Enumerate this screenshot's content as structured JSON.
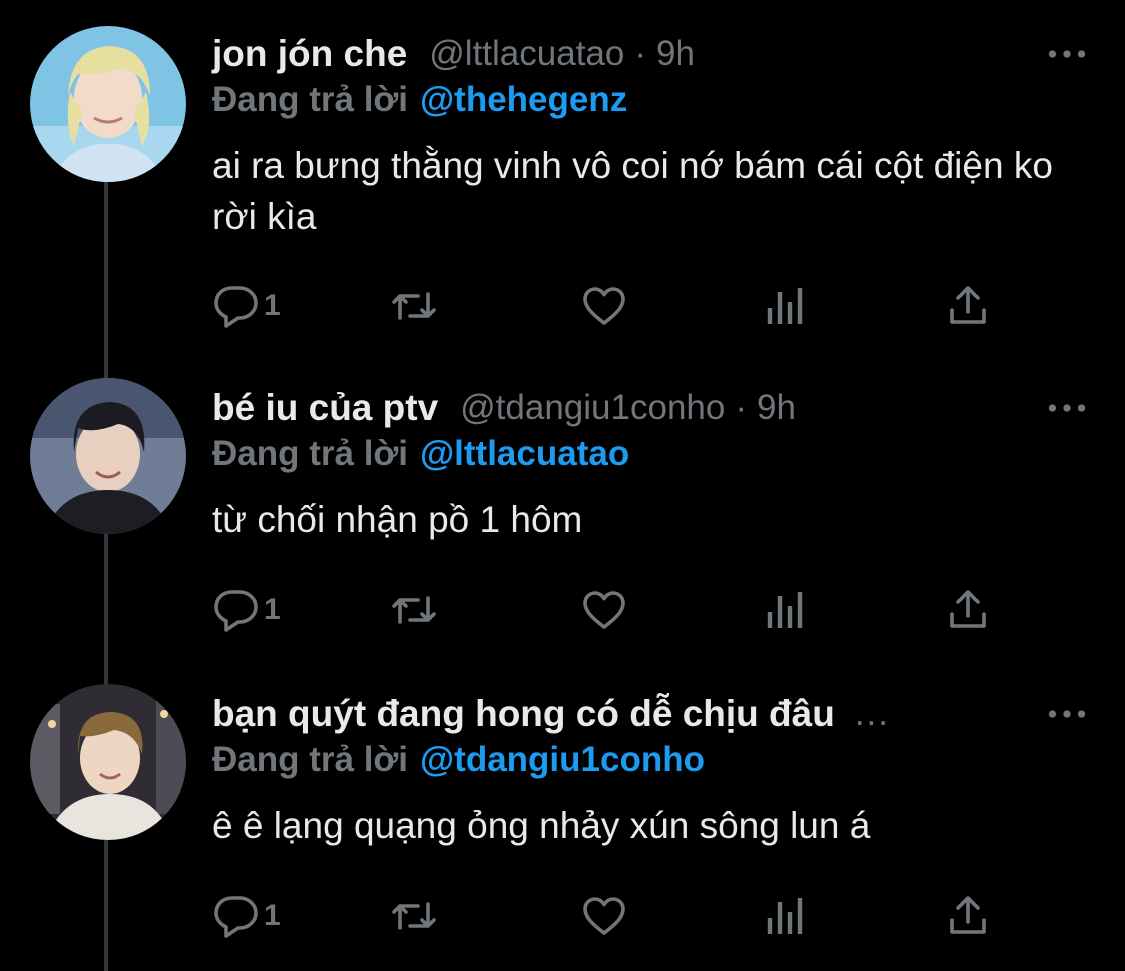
{
  "tweets": [
    {
      "display_name": "jon jón che",
      "handle": "@lttlacuatao",
      "separator": "·",
      "time": "9h",
      "truncated": "",
      "reply_label": "Đang trả lời",
      "reply_to": "@thehegenz",
      "text": "ai ra bưng thằng vinh vô coi nớ bám cái cột điện ko rời kìa",
      "reply_count": "1",
      "avatar_icon": "avatar-blonde-hair"
    },
    {
      "display_name": "bé iu của ptv",
      "handle": "@tdangiu1conho",
      "separator": "·",
      "time": "9h",
      "truncated": "",
      "reply_label": "Đang trả lời",
      "reply_to": "@lttlacuatao",
      "text": "từ chối nhận pồ 1 hôm",
      "reply_count": "1",
      "avatar_icon": "avatar-dark-hair"
    },
    {
      "display_name": "bạn quýt đang hong có dễ chịu đâu",
      "handle": "",
      "separator": "",
      "time": "",
      "truncated": "...",
      "reply_label": "Đang trả lời",
      "reply_to": "@tdangiu1conho",
      "text": "ê ê lạng quạng ỏng nhảy xún sông lun á",
      "reply_count": "1",
      "avatar_icon": "avatar-city-night"
    }
  ],
  "icons": {
    "reply": "reply-icon",
    "retweet": "retweet-icon",
    "like": "heart-icon",
    "views": "views-icon",
    "share": "share-icon",
    "more": "more-icon"
  },
  "colors": {
    "background": "#000000",
    "text": "#e7e9ea",
    "secondary": "#71767b",
    "mention": "#1d9bf0",
    "thread_line": "#333639"
  }
}
